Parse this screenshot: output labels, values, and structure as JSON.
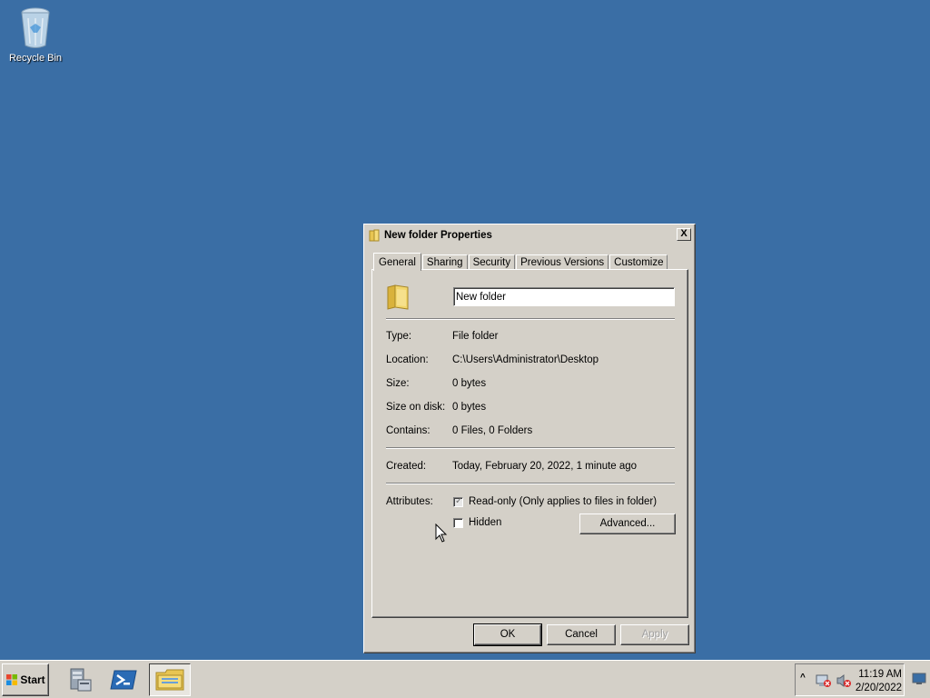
{
  "desktop": {
    "recycle_bin_label": "Recycle Bin"
  },
  "dialog": {
    "title": "New folder Properties",
    "close_glyph": "X",
    "tabs": [
      "General",
      "Sharing",
      "Security",
      "Previous Versions",
      "Customize"
    ],
    "active_tab": "General",
    "name_value": "New folder",
    "rows": {
      "type_label": "Type:",
      "type_value": "File folder",
      "location_label": "Location:",
      "location_value": "C:\\Users\\Administrator\\Desktop",
      "size_label": "Size:",
      "size_value": "0 bytes",
      "size_on_disk_label": "Size on disk:",
      "size_on_disk_value": "0 bytes",
      "contains_label": "Contains:",
      "contains_value": "0 Files, 0 Folders",
      "created_label": "Created:",
      "created_value": "Today, February 20, 2022, 1 minute ago"
    },
    "attributes_label": "Attributes:",
    "readonly_label": "Read-only (Only applies to files in folder)",
    "readonly_checked": true,
    "hidden_label": "Hidden",
    "hidden_checked": false,
    "advanced_label": "Advanced...",
    "ok_label": "OK",
    "cancel_label": "Cancel",
    "apply_label": "Apply"
  },
  "taskbar": {
    "start_label": "Start",
    "clock_time": "11:19 AM",
    "clock_date": "2/20/2022",
    "tray_arrow": "^"
  },
  "colors": {
    "desktop": "#3a6ea5",
    "chrome": "#d4d0c8"
  }
}
